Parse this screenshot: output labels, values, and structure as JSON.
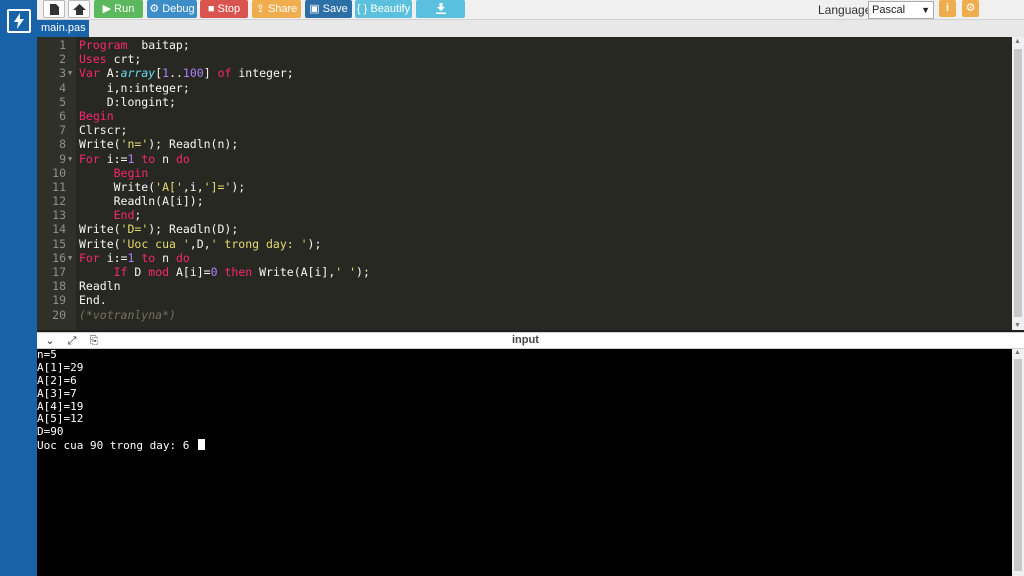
{
  "toolbar": {
    "run": "Run",
    "debug": "Debug",
    "stop": "Stop",
    "share": "Share",
    "save": "Save",
    "beautify": "{ } Beautify",
    "language_label": "Language",
    "language_value": "Pascal",
    "info_label": "i"
  },
  "tab": {
    "filename": "main.pas"
  },
  "editor": {
    "lines": [
      {
        "n": "1",
        "fold": false,
        "tokens": [
          [
            "kw",
            "Program"
          ],
          [
            "",
            "  baitap;"
          ]
        ]
      },
      {
        "n": "2",
        "fold": false,
        "tokens": [
          [
            "kw",
            "Uses"
          ],
          [
            "",
            " crt;"
          ]
        ]
      },
      {
        "n": "3",
        "fold": true,
        "tokens": [
          [
            "kw",
            "Var"
          ],
          [
            "",
            " A:"
          ],
          [
            "ty",
            "array"
          ],
          [
            "",
            "["
          ],
          [
            "nu",
            "1"
          ],
          [
            "",
            ".."
          ],
          [
            "nu",
            "100"
          ],
          [
            "",
            "] "
          ],
          [
            "kw",
            "of"
          ],
          [
            "",
            " integer;"
          ]
        ]
      },
      {
        "n": "4",
        "fold": false,
        "tokens": [
          [
            "",
            "    i,n:integer;"
          ]
        ]
      },
      {
        "n": "5",
        "fold": false,
        "tokens": [
          [
            "",
            "    D:longint;"
          ]
        ]
      },
      {
        "n": "6",
        "fold": false,
        "tokens": [
          [
            "kw",
            "Begin"
          ]
        ]
      },
      {
        "n": "7",
        "fold": false,
        "tokens": [
          [
            "",
            "Clrscr;"
          ]
        ]
      },
      {
        "n": "8",
        "fold": false,
        "tokens": [
          [
            "",
            "Write("
          ],
          [
            "st",
            "'n='"
          ],
          [
            "",
            "); Readln(n);"
          ]
        ]
      },
      {
        "n": "9",
        "fold": true,
        "tokens": [
          [
            "kw",
            "For"
          ],
          [
            "",
            " i:="
          ],
          [
            "nu",
            "1"
          ],
          [
            "",
            " "
          ],
          [
            "kw",
            "to"
          ],
          [
            "",
            " n "
          ],
          [
            "kw",
            "do"
          ]
        ]
      },
      {
        "n": "10",
        "fold": false,
        "tokens": [
          [
            "",
            "     "
          ],
          [
            "kw",
            "Begin"
          ]
        ]
      },
      {
        "n": "11",
        "fold": false,
        "tokens": [
          [
            "",
            "     Write("
          ],
          [
            "st",
            "'A['"
          ],
          [
            "",
            ",i,"
          ],
          [
            "st",
            "']='"
          ],
          [
            "",
            ");"
          ]
        ]
      },
      {
        "n": "12",
        "fold": false,
        "tokens": [
          [
            "",
            "     Readln(A[i]);"
          ]
        ]
      },
      {
        "n": "13",
        "fold": false,
        "tokens": [
          [
            "",
            "     "
          ],
          [
            "kw",
            "End"
          ],
          [
            "",
            ";"
          ]
        ]
      },
      {
        "n": "14",
        "fold": false,
        "tokens": [
          [
            "",
            "Write("
          ],
          [
            "st",
            "'D='"
          ],
          [
            "",
            "); Readln(D);"
          ]
        ]
      },
      {
        "n": "15",
        "fold": false,
        "tokens": [
          [
            "",
            "Write("
          ],
          [
            "st",
            "'Uoc cua '"
          ],
          [
            "",
            ",D,"
          ],
          [
            "st",
            "' trong day: '"
          ],
          [
            "",
            ");"
          ]
        ]
      },
      {
        "n": "16",
        "fold": true,
        "tokens": [
          [
            "kw",
            "For"
          ],
          [
            "",
            " i:="
          ],
          [
            "nu",
            "1"
          ],
          [
            "",
            " "
          ],
          [
            "kw",
            "to"
          ],
          [
            "",
            " n "
          ],
          [
            "kw",
            "do"
          ]
        ]
      },
      {
        "n": "17",
        "fold": false,
        "tokens": [
          [
            "",
            "     "
          ],
          [
            "kw",
            "If"
          ],
          [
            "",
            " D "
          ],
          [
            "kw",
            "mod"
          ],
          [
            "",
            " A[i]="
          ],
          [
            "nu",
            "0"
          ],
          [
            "",
            " "
          ],
          [
            "kw",
            "then"
          ],
          [
            "",
            " Write(A[i],"
          ],
          [
            "st",
            "' '"
          ],
          [
            "",
            ");"
          ]
        ]
      },
      {
        "n": "18",
        "fold": false,
        "tokens": [
          [
            "",
            "Readln"
          ]
        ]
      },
      {
        "n": "19",
        "fold": false,
        "tokens": [
          [
            "",
            "End."
          ]
        ]
      },
      {
        "n": "20",
        "fold": false,
        "tokens": [
          [
            "cm",
            "(*votranlyna*)"
          ]
        ]
      }
    ]
  },
  "console": {
    "label": "input",
    "output": [
      "n=5",
      "A[1]=29",
      "A[2]=6",
      "A[3]=7",
      "A[4]=19",
      "A[5]=12",
      "D=90",
      "Uoc cua 90 trong day: 6 "
    ]
  },
  "colors": {
    "brand_blue": "#1862a8",
    "run_green": "#5cb85c",
    "stop_red": "#d9534f",
    "share_orange": "#f0ad4e",
    "editor_bg": "#272822"
  },
  "icons": {
    "logo": "lightning-bolt-icon",
    "new": "new-file-icon",
    "open": "open-project-icon",
    "run": "play-icon",
    "debug": "debug-icon",
    "stop": "stop-icon",
    "share": "share-icon",
    "save": "floppy-disk-icon",
    "download": "download-icon",
    "settings": "gear-icon"
  }
}
